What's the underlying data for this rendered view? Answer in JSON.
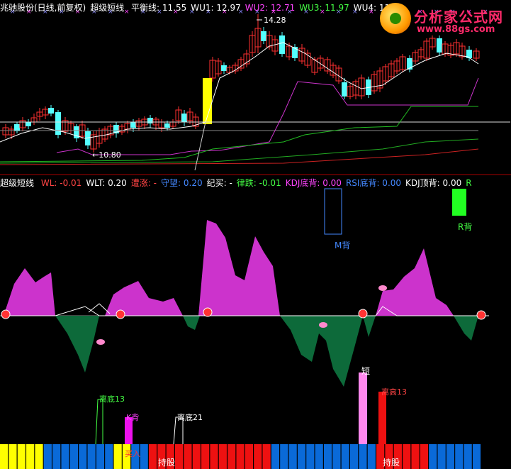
{
  "header_top": {
    "stock_name": "兆驰股份(日线,前复权)",
    "indicator": "超级短线",
    "items": [
      {
        "label": "平衡线: 11.55",
        "color": "#ffffff"
      },
      {
        "label": "WU1: 12.97",
        "color": "#ffffff"
      },
      {
        "label": "WU2: 12.71",
        "color": "#ff44ff"
      },
      {
        "label": "WU3: 11.97",
        "color": "#44ff44"
      },
      {
        "label": "WU4: 11.3",
        "color": "#ffffff"
      }
    ]
  },
  "header_mid": {
    "indicator": "超级短线",
    "items": [
      {
        "label": "WL: -0.01",
        "color": "#ff4444"
      },
      {
        "label": "WLT: 0.20",
        "color": "#ffffff"
      },
      {
        "label": "遭涨: -",
        "color": "#ff4444"
      },
      {
        "label": "守望: 0.20",
        "color": "#4488ff"
      },
      {
        "label": "纪买: -",
        "color": "#ffffff"
      },
      {
        "label": "律跌: -0.01",
        "color": "#44ff44"
      },
      {
        "label": "KDJ底背: 0.00",
        "color": "#ff44ff"
      },
      {
        "label": "RSI底背: 0.00",
        "color": "#4488ff"
      },
      {
        "label": "KDJ顶背: 0.00",
        "color": "#ffffff"
      },
      {
        "label": "R",
        "color": "#44ff44"
      }
    ]
  },
  "logo": {
    "title": "分析家公式网",
    "url": "www.88gs.com"
  },
  "annotations": {
    "high_price": "14.28",
    "low_price": "10.80",
    "m_back": "M背",
    "r_back": "R背",
    "k_back": "K背",
    "duan": "短",
    "lidi13": "离底13",
    "lidi21": "离底21",
    "ligao13": "离高13",
    "mairu": "买入",
    "chigu1": "持股",
    "chigu2": "持股"
  },
  "chart_data": [
    {
      "type": "candlestick",
      "title": "兆驰股份(日线,前复权)",
      "annotations": {
        "max": 14.28,
        "min": 10.8
      },
      "series": [
        {
          "name": "平衡线",
          "last": 11.55
        },
        {
          "name": "WU1",
          "last": 12.97
        },
        {
          "name": "WU2",
          "last": 12.71
        },
        {
          "name": "WU3",
          "last": 11.97
        },
        {
          "name": "WU4",
          "last": 11.3
        }
      ]
    },
    {
      "type": "area",
      "title": "超级短线",
      "series": [
        {
          "name": "WL",
          "last": -0.01
        },
        {
          "name": "WLT",
          "last": 0.2
        }
      ]
    }
  ],
  "colors": {
    "up": "#ff3030",
    "down": "#54ffff",
    "pink": "#cc33cc",
    "green": "#0d6a3a",
    "yellow": "#ffff00",
    "blue": "#0a6ad8",
    "red": "#ee1111"
  }
}
